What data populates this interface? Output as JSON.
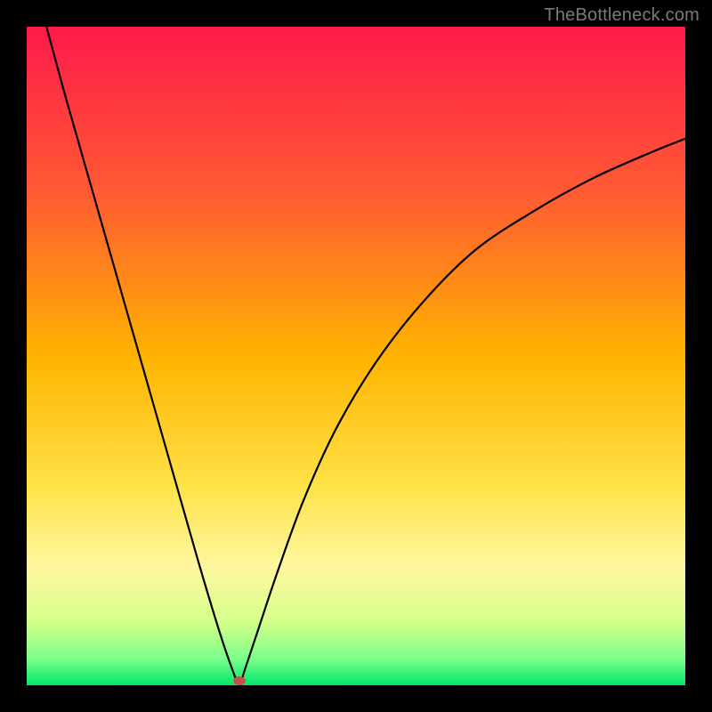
{
  "watermark": {
    "text": "TheBottleneck.com"
  },
  "chart_data": {
    "type": "line",
    "title": "",
    "xlabel": "",
    "ylabel": "",
    "xlim": [
      0,
      100
    ],
    "ylim": [
      0,
      100
    ],
    "grid": false,
    "legend": false,
    "background_gradient_stops": [
      {
        "offset": 0,
        "color": "#ff1a4b"
      },
      {
        "offset": 0.25,
        "color": "#ff5a33"
      },
      {
        "offset": 0.5,
        "color": "#ffb300"
      },
      {
        "offset": 0.7,
        "color": "#ffe24a"
      },
      {
        "offset": 0.82,
        "color": "#fff7a0"
      },
      {
        "offset": 0.9,
        "color": "#d8ff8a"
      },
      {
        "offset": 0.96,
        "color": "#7bff8a"
      },
      {
        "offset": 1.0,
        "color": "#00e66b"
      }
    ],
    "series": [
      {
        "name": "bottleneck-curve",
        "x": [
          3,
          6,
          10,
          14,
          18,
          22,
          26,
          29,
          31,
          32.3,
          33,
          35,
          38,
          42,
          47,
          53,
          60,
          68,
          77,
          86,
          95,
          100
        ],
        "y": [
          100,
          89,
          75,
          61,
          47,
          33,
          19,
          9,
          3,
          0,
          2,
          8,
          17,
          28,
          39,
          49,
          58,
          66,
          72,
          77,
          81,
          83
        ]
      }
    ],
    "marker": {
      "x": 32.3,
      "y": 0.7,
      "color": "#c94f4f"
    }
  }
}
